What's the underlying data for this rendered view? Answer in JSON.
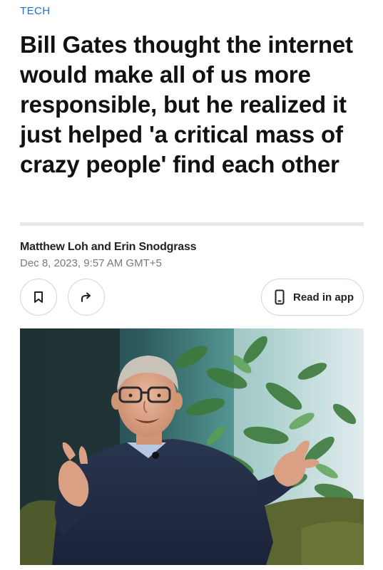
{
  "article": {
    "category": "TECH",
    "headline": "Bill Gates thought the internet would make all of us more responsible, but he realized it just helped 'a critical mass of crazy people' find each other",
    "authors": "Matthew Loh and Erin Snodgrass",
    "timestamp": "Dec 8, 2023, 9:57 AM GMT+5"
  },
  "actions": {
    "bookmark_icon": "bookmark-icon",
    "share_icon": "share-arrow-icon",
    "read_in_app_label": "Read in app",
    "read_in_app_icon": "phone-icon"
  },
  "colors": {
    "category": "#1f6fd1",
    "headline": "#111111",
    "timestamp": "#7a7a7a",
    "button_border": "#d4d4d4"
  }
}
